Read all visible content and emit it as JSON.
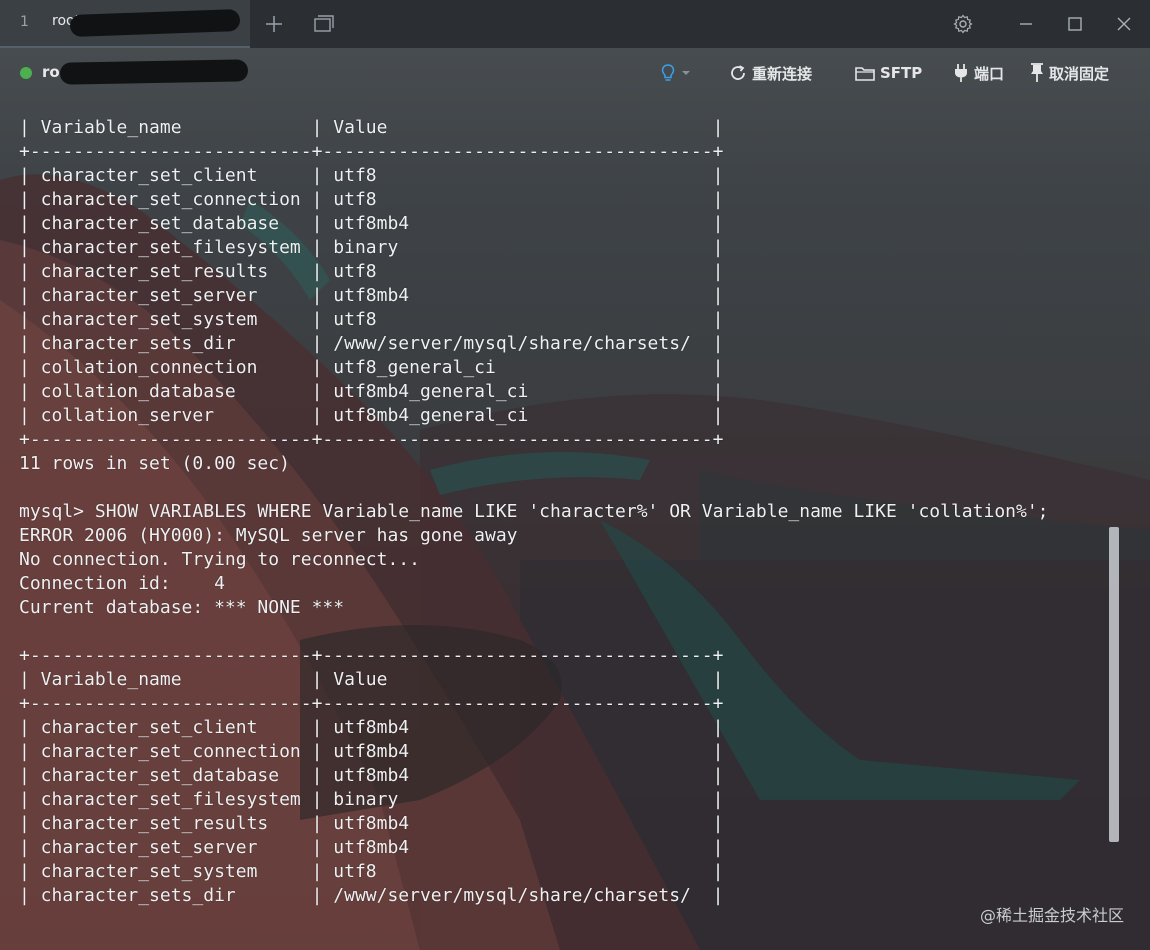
{
  "tab": {
    "index": "1",
    "title": "root@           us:~"
  },
  "toolbar": {
    "host": "root@1",
    "actions": {
      "reconnect": "重新连接",
      "sftp": "SFTP",
      "port": "端口",
      "unpin": "取消固定"
    }
  },
  "terminal": {
    "lines": [
      "| Variable_name            | Value                              |",
      "+--------------------------+------------------------------------+",
      "| character_set_client     | utf8                               |",
      "| character_set_connection | utf8                               |",
      "| character_set_database   | utf8mb4                            |",
      "| character_set_filesystem | binary                             |",
      "| character_set_results    | utf8                               |",
      "| character_set_server     | utf8mb4                            |",
      "| character_set_system     | utf8                               |",
      "| character_sets_dir       | /www/server/mysql/share/charsets/  |",
      "| collation_connection     | utf8_general_ci                    |",
      "| collation_database       | utf8mb4_general_ci                 |",
      "| collation_server         | utf8mb4_general_ci                 |",
      "+--------------------------+------------------------------------+",
      "11 rows in set (0.00 sec)",
      "",
      "mysql> SHOW VARIABLES WHERE Variable_name LIKE 'character%' OR Variable_name LIKE 'collation%';",
      "ERROR 2006 (HY000): MySQL server has gone away",
      "No connection. Trying to reconnect...",
      "Connection id:    4",
      "Current database: *** NONE ***",
      "",
      "+--------------------------+------------------------------------+",
      "| Variable_name            | Value                              |",
      "+--------------------------+------------------------------------+",
      "| character_set_client     | utf8mb4                            |",
      "| character_set_connection | utf8mb4                            |",
      "| character_set_database   | utf8mb4                            |",
      "| character_set_filesystem | binary                             |",
      "| character_set_results    | utf8mb4                            |",
      "| character_set_server     | utf8mb4                            |",
      "| character_set_system     | utf8                               |",
      "| character_sets_dir       | /www/server/mysql/share/charsets/  |"
    ]
  },
  "watermark": "@稀土掘金技术社区",
  "colors": {
    "status_dot": "#4caf50",
    "terminal_text": "#eef0f2",
    "lightbulb": "#3aa0e8"
  },
  "icons": {
    "settings": "gear-icon",
    "minimize": "minimize-icon",
    "maximize": "maximize-icon",
    "close": "close-icon",
    "new_tab": "plus-icon",
    "tab_list": "window-stack-icon",
    "hint": "lightbulb-icon",
    "reconnect": "refresh-icon",
    "sftp": "folder-icon",
    "port": "plug-icon",
    "unpin": "pin-icon"
  }
}
